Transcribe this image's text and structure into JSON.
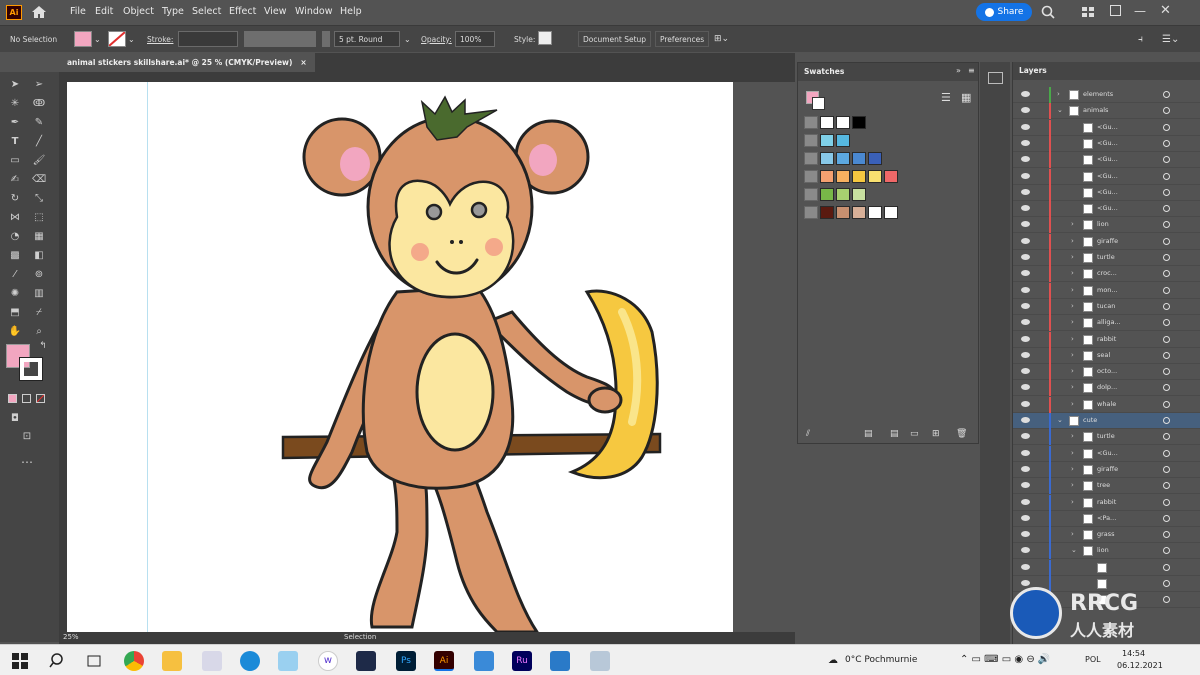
{
  "app": {
    "logo": "Ai",
    "accent": "#1473e6",
    "share_label": "Share"
  },
  "menu": [
    "File",
    "Edit",
    "Object",
    "Type",
    "Select",
    "Effect",
    "View",
    "Window",
    "Help"
  ],
  "control": {
    "selection": "No Selection",
    "stroke_label": "Stroke:",
    "stroke_profile": "5 pt. Round",
    "opacity_label": "Opacity:",
    "opacity_value": "100%",
    "style_label": "Style:",
    "doc_setup": "Document Setup",
    "preferences": "Preferences",
    "fill_color": "#f2a6c0"
  },
  "document": {
    "tab_title": "animal stickers skillshare.ai* @ 25 % (CMYK/Preview)",
    "close": "×"
  },
  "status": {
    "zoom": "25%",
    "mode": "Selection"
  },
  "swatches_panel": {
    "title": "Swatches",
    "rows": [
      [
        "#ffffff",
        "#ffffff",
        "#000000"
      ],
      [
        "#7fd0e8",
        "#56b8e0"
      ],
      [
        "#88c8e8",
        "#5ca8e0",
        "#4a88d0",
        "#3a60b8"
      ],
      [
        "#f4a070",
        "#f6b060",
        "#f6c840",
        "#f8e070",
        "#f06868"
      ],
      [
        "#78b848",
        "#a8d070",
        "#c8e0a0"
      ],
      [
        "#5a1a10",
        "#c89070",
        "#d8b098",
        "#ffffff",
        "#ffffff"
      ]
    ]
  },
  "layers_panel": {
    "title": "Layers",
    "rows": [
      {
        "name": "elements",
        "indent": 0,
        "color": "#4aa84a",
        "expand": "›"
      },
      {
        "name": "animals",
        "indent": 0,
        "color": "#e05050",
        "expand": "⌄"
      },
      {
        "name": "<Gu...",
        "indent": 1,
        "color": "#e05050",
        "expand": ""
      },
      {
        "name": "<Gu...",
        "indent": 1,
        "color": "#e05050",
        "expand": ""
      },
      {
        "name": "<Gu...",
        "indent": 1,
        "color": "#e05050",
        "expand": ""
      },
      {
        "name": "<Gu...",
        "indent": 1,
        "color": "#e05050",
        "expand": ""
      },
      {
        "name": "<Gu...",
        "indent": 1,
        "color": "#e05050",
        "expand": ""
      },
      {
        "name": "<Gu...",
        "indent": 1,
        "color": "#e05050",
        "expand": ""
      },
      {
        "name": "lion",
        "indent": 1,
        "color": "#e05050",
        "expand": "›"
      },
      {
        "name": "giraffe",
        "indent": 1,
        "color": "#e05050",
        "expand": "›"
      },
      {
        "name": "turtle",
        "indent": 1,
        "color": "#e05050",
        "expand": "›"
      },
      {
        "name": "croc...",
        "indent": 1,
        "color": "#e05050",
        "expand": "›"
      },
      {
        "name": "mon...",
        "indent": 1,
        "color": "#e05050",
        "expand": "›"
      },
      {
        "name": "tucan",
        "indent": 1,
        "color": "#e05050",
        "expand": "›"
      },
      {
        "name": "alliga...",
        "indent": 1,
        "color": "#e05050",
        "expand": "›"
      },
      {
        "name": "rabbit",
        "indent": 1,
        "color": "#e05050",
        "expand": "›"
      },
      {
        "name": "seal",
        "indent": 1,
        "color": "#e05050",
        "expand": "›"
      },
      {
        "name": "octo...",
        "indent": 1,
        "color": "#e05050",
        "expand": "›"
      },
      {
        "name": "dolp...",
        "indent": 1,
        "color": "#e05050",
        "expand": "›"
      },
      {
        "name": "whale",
        "indent": 1,
        "color": "#e05050",
        "expand": "›"
      },
      {
        "name": "cute",
        "indent": 0,
        "color": "#3a6ad0",
        "expand": "⌄"
      },
      {
        "name": "turtle",
        "indent": 1,
        "color": "#3a6ad0",
        "expand": "›"
      },
      {
        "name": "<Gu...",
        "indent": 1,
        "color": "#3a6ad0",
        "expand": "›"
      },
      {
        "name": "giraffe",
        "indent": 1,
        "color": "#3a6ad0",
        "expand": "›"
      },
      {
        "name": "tree",
        "indent": 1,
        "color": "#3a6ad0",
        "expand": "›"
      },
      {
        "name": "rabbit",
        "indent": 1,
        "color": "#3a6ad0",
        "expand": "›"
      },
      {
        "name": "<Pa...",
        "indent": 1,
        "color": "#3a6ad0",
        "expand": ""
      },
      {
        "name": "grass",
        "indent": 1,
        "color": "#3a6ad0",
        "expand": "›"
      },
      {
        "name": "lion",
        "indent": 1,
        "color": "#3a6ad0",
        "expand": "⌄"
      },
      {
        "name": "",
        "indent": 2,
        "color": "#3a6ad0",
        "expand": ""
      },
      {
        "name": "",
        "indent": 2,
        "color": "#3a6ad0",
        "expand": ""
      },
      {
        "name": "",
        "indent": 2,
        "color": "#3a6ad0",
        "expand": ""
      }
    ]
  },
  "taskbar": {
    "weather": "0°C  Pochmurnie",
    "lang": "POL",
    "time": "14:54",
    "date": "06.12.2021"
  },
  "watermark": {
    "brand": "RRCG",
    "sub": "人人素材"
  }
}
